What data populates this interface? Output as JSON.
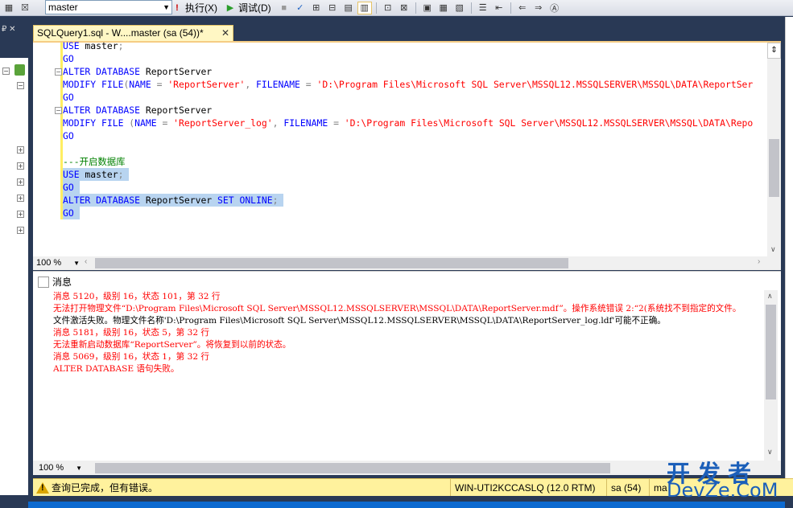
{
  "toolbar": {
    "database": "master",
    "execute_label": "执行(X)",
    "debug_label": "调试(D)"
  },
  "tab": {
    "title": "SQLQuery1.sql - W....master (sa (54))*",
    "close": "✕"
  },
  "editor": {
    "lines": [
      "USE master;",
      "GO",
      "ALTER DATABASE ReportServer",
      "MODIFY FILE(NAME = 'ReportServer', FILENAME = 'D:\\Program Files\\Microsoft SQL Server\\MSSQL12.MSSQLSERVER\\MSSQL\\DATA\\ReportSer",
      "GO",
      "ALTER DATABASE ReportServer",
      "MODIFY FILE (NAME = 'ReportServer_log', FILENAME = 'D:\\Program Files\\Microsoft SQL Server\\MSSQL12.MSSQLSERVER\\MSSQL\\DATA\\Repo",
      "GO",
      "",
      "---开启数据库",
      "USE master;",
      "GO",
      "ALTER DATABASE ReportServer SET ONLINE;",
      "GO"
    ]
  },
  "zoom": {
    "editor": "100 %",
    "results": "100 %"
  },
  "results": {
    "tab_label": "消息",
    "messages": [
      {
        "text": "消息 5120，级别 16，状态 101，第 32 行",
        "color": "#ff0000"
      },
      {
        "text": "无法打开物理文件“D:\\Program Files\\Microsoft SQL Server\\MSSQL12.MSSQLSERVER\\MSSQL\\DATA\\ReportServer.mdf”。操作系统错误 2:“2(系统找不到指定的文件。",
        "color": "#ff0000"
      },
      {
        "text": "文件激活失败。物理文件名称'D:\\Program Files\\Microsoft SQL Server\\MSSQL12.MSSQLSERVER\\MSSQL\\DATA\\ReportServer_log.ldf'可能不正确。",
        "color": "#000000"
      },
      {
        "text": "消息 5181，级别 16，状态 5，第 32 行",
        "color": "#ff0000"
      },
      {
        "text": "无法重新启动数据库“ReportServer”。将恢复到以前的状态。",
        "color": "#ff0000"
      },
      {
        "text": "消息 5069，级别 16，状态 1，第 32 行",
        "color": "#ff0000"
      },
      {
        "text": "ALTER DATABASE 语句失败。",
        "color": "#ff0000"
      }
    ]
  },
  "status": {
    "message": "查询已完成，但有错误。",
    "server": "WIN-UTI2KCCASLQ (12.0 RTM)",
    "user": "sa (54)",
    "db": "ma"
  },
  "watermark": {
    "top": "开发者",
    "bottom": "DevZe.CoM"
  }
}
